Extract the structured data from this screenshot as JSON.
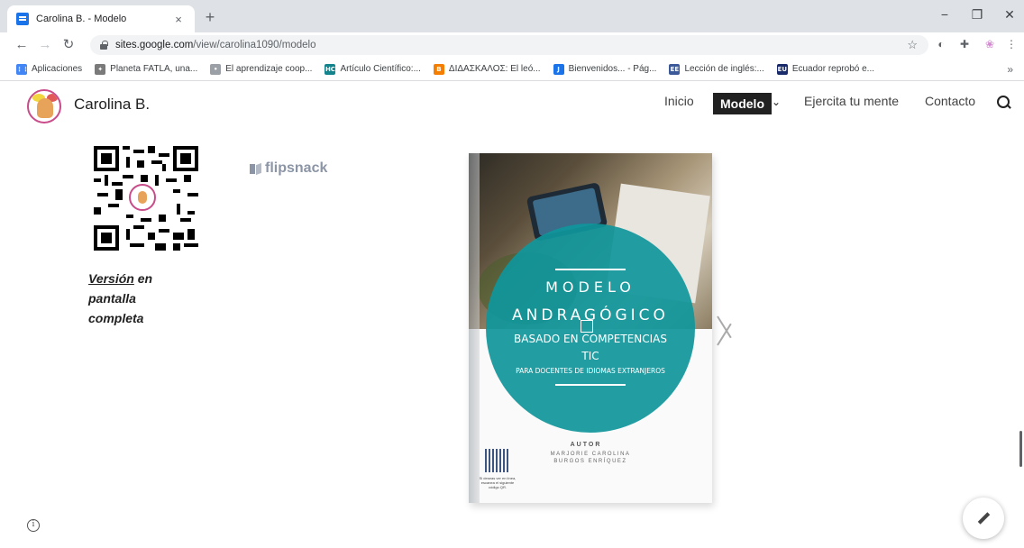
{
  "browser": {
    "tab_title": "Carolina B. - Modelo",
    "tab_close": "×",
    "new_tab": "+",
    "window_min": "−",
    "window_restore": "❐",
    "window_close": "✕",
    "url_host": "sites.google.com",
    "url_path": "/view/carolina1090/modelo",
    "star": "☆",
    "bookmarks": [
      {
        "label": "Aplicaciones",
        "icon": "apps-grid-icon",
        "color": "#4285f4",
        "glyph": "⋮⋮"
      },
      {
        "label": "Planeta FATLA, una...",
        "icon": "planeta-fatla-icon",
        "color": "#7a7a7a",
        "glyph": "✦"
      },
      {
        "label": "El aprendizaje coop...",
        "icon": "aprendizaje-icon",
        "color": "#9aa0a6",
        "glyph": "•"
      },
      {
        "label": "Artículo Científico:...",
        "icon": "hc-icon",
        "color": "#13838c",
        "glyph": "HC"
      },
      {
        "label": "ΔΙΔΑΣΚΑΛΟΣ: El leó...",
        "icon": "blogger-icon",
        "color": "#f57d00",
        "glyph": "B"
      },
      {
        "label": "Bienvenidos... - Pág...",
        "icon": "jimdo-icon",
        "color": "#1a73e8",
        "glyph": "J"
      },
      {
        "label": "Lección de inglés:...",
        "icon": "leccion-icon",
        "color": "#3b5998",
        "glyph": "EE"
      },
      {
        "label": "Ecuador reprobó e...",
        "icon": "eu-icon",
        "color": "#1a2b6b",
        "glyph": "EU"
      }
    ],
    "bookmarks_more": "»"
  },
  "site": {
    "title": "Carolina B.",
    "nav": {
      "home": "Inicio",
      "model": "Modelo",
      "exercise": "Ejercita tu mente",
      "contact": "Contacto"
    }
  },
  "content": {
    "fullscreen_link": "Versión",
    "fullscreen_rest": " en pantalla completa",
    "flipsnack": "flipsnack",
    "book": {
      "title1": "MODELO",
      "title2": "ANDRAGÓGICO",
      "sub1": "BASADO EN COMPETENCIAS",
      "sub2": "TIC",
      "sub3": "PARA DOCENTES DE IDIOMAS EXTRANJEROS",
      "author_label": "AUTOR",
      "author_name": "MARJORIE CAROLINA BURGOS ENRÍQUEZ",
      "qr_caption": "Si deseas ver en línea, escanea el siguiente código QR."
    }
  },
  "colors": {
    "accent_teal": "#0f969b",
    "nav_active_bg": "#212121"
  }
}
